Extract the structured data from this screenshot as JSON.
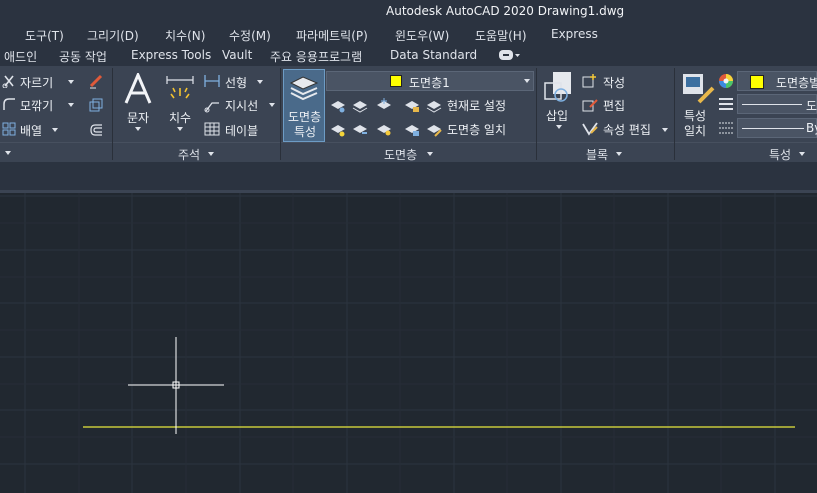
{
  "window": {
    "title": "Autodesk AutoCAD 2020    Drawing1.dwg"
  },
  "menu": {
    "items": [
      "도구(T)",
      "그리기(D)",
      "치수(N)",
      "수정(M)",
      "파라메트릭(P)",
      "윈도우(W)",
      "도움말(H)",
      "Express"
    ]
  },
  "ribbon_tabs": [
    "애드인",
    "공동 작업",
    "Express Tools",
    "Vault",
    "주요 응용프로그램",
    "Data Standard"
  ],
  "ribbon": {
    "modify": {
      "trim": "자르기",
      "fillet": "모깎기",
      "array": "배열"
    },
    "annotation": {
      "text": "문자",
      "dimension": "치수",
      "linear": "선형",
      "leader": "지시선",
      "table": "테이블",
      "panel_title": "주석"
    },
    "layers": {
      "layer_properties_line1": "도면층",
      "layer_properties_line2": "특성",
      "current_layer": "도면층1",
      "set_current": "현재로 설정",
      "match_layer": "도면층 일치",
      "panel_title": "도면층"
    },
    "block": {
      "insert": "삽입",
      "create": "작성",
      "edit": "편집",
      "edit_attributes": "속성 편집",
      "panel_title": "블록"
    },
    "properties": {
      "match_line1": "특성",
      "match_line2": "일치",
      "color_value": "도면층별",
      "linetype_value": "도",
      "lineweight_value": "By",
      "panel_title": "특성"
    }
  },
  "colors": {
    "layer_color": "#ffff00",
    "canvas": "#212830",
    "ribbon": "#3b4453",
    "drawn_line": "#e8e83c"
  }
}
